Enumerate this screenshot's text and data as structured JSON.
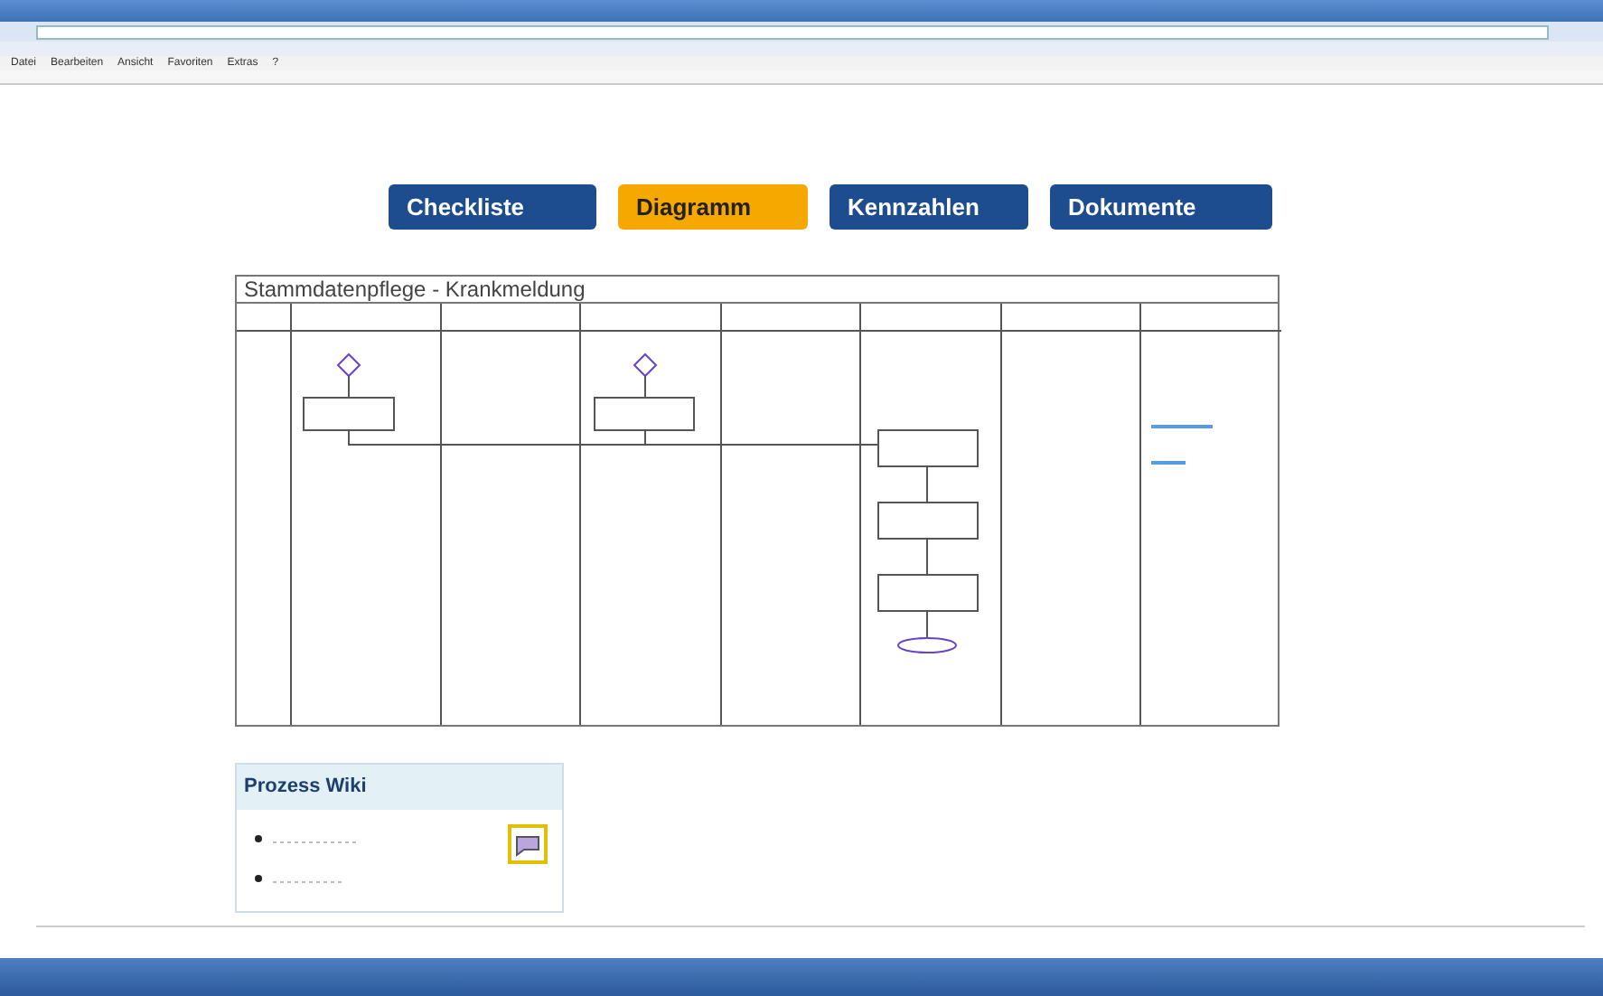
{
  "browser": {
    "menu": [
      "Datei",
      "Bearbeiten",
      "Ansicht",
      "Favoriten",
      "Extras",
      "?"
    ]
  },
  "nav_tabs": [
    {
      "label": "Checkliste",
      "selected": false
    },
    {
      "label": "Diagramm",
      "selected": true
    },
    {
      "label": "Kennzahlen",
      "selected": false
    },
    {
      "label": "Dokumente",
      "selected": false
    }
  ],
  "diagram": {
    "title": "Stammdatenpflege - Krankmeldung"
  },
  "wiki": {
    "title": "Prozess Wiki"
  }
}
